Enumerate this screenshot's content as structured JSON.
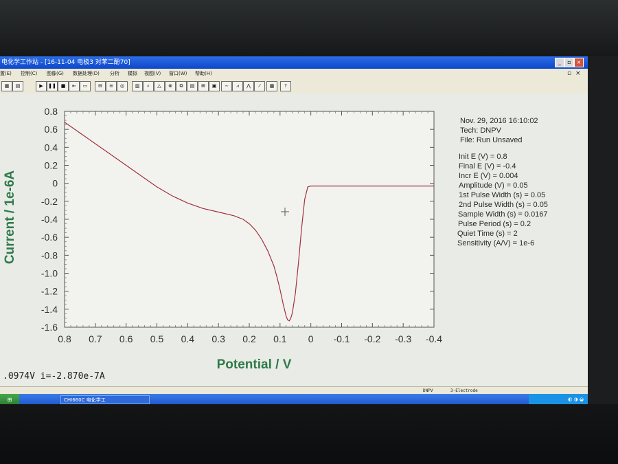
{
  "window": {
    "title": "电化学工作站 - [16-11-04 电极3 对苯二酚70]"
  },
  "menu": [
    "置(E)",
    "控制(C)",
    "图像(G)",
    "数据处理(D)",
    "分析",
    "模拟",
    "视图(V)",
    "窗口(W)",
    "帮助(H)"
  ],
  "info_panel": {
    "date": "Nov. 29, 2016   16:10:02",
    "tech": "Tech: DNPV",
    "file": "File: Run Unsaved",
    "params": [
      "Init E (V) = 0.8",
      "Final E (V) = -0.4",
      "Incr E (V) = 0.004",
      "Amplitude (V) = 0.05",
      "1st Pulse Width (s) = 0.05",
      "2nd Pulse Width (s) = 0.05",
      "Sample Width (s) = 0.0167",
      "Pulse Period (s) = 0.2",
      "Quiet Time (s) = 2",
      "Sensitivity (A/V) = 1e-6"
    ]
  },
  "readout": ".0974V   i=-2.870e-7A",
  "status": {
    "technique": "DNPV",
    "electrode": "3-Electrode"
  },
  "taskbar": {
    "item": "CHI660C 电化学工"
  },
  "chart_data": {
    "type": "line",
    "xlabel": "Potential / V",
    "ylabel": "Current / 1e-6A",
    "xlim": [
      0.8,
      -0.4
    ],
    "ylim": [
      -1.6,
      0.8
    ],
    "x_ticks": [
      "0.8",
      "0.7",
      "0.6",
      "0.5",
      "0.4",
      "0.3",
      "0.2",
      "0.1",
      "0",
      "-0.1",
      "-0.2",
      "-0.3",
      "-0.4"
    ],
    "y_ticks": [
      "0.8",
      "0.6",
      "0.4",
      "0.2",
      "0",
      "-0.2",
      "-0.4",
      "-0.6",
      "-0.8",
      "-1.0",
      "-1.2",
      "-1.4",
      "-1.6"
    ],
    "series": [
      {
        "color": "#a0303a",
        "x": [
          0.8,
          0.75,
          0.7,
          0.65,
          0.6,
          0.55,
          0.5,
          0.45,
          0.4,
          0.35,
          0.3,
          0.25,
          0.22,
          0.2,
          0.18,
          0.16,
          0.14,
          0.12,
          0.11,
          0.1,
          0.09,
          0.08,
          0.075,
          0.07,
          0.065,
          0.06,
          0.05,
          0.04,
          0.03,
          0.02,
          0.01,
          0.0,
          -0.1,
          -0.2,
          -0.3,
          -0.4
        ],
        "y": [
          0.68,
          0.56,
          0.44,
          0.32,
          0.2,
          0.08,
          -0.04,
          -0.14,
          -0.22,
          -0.28,
          -0.32,
          -0.36,
          -0.4,
          -0.45,
          -0.52,
          -0.62,
          -0.75,
          -0.92,
          -1.04,
          -1.18,
          -1.34,
          -1.48,
          -1.52,
          -1.53,
          -1.5,
          -1.44,
          -1.22,
          -0.88,
          -0.5,
          -0.18,
          -0.04,
          -0.03,
          -0.03,
          -0.03,
          -0.03,
          -0.03
        ]
      }
    ],
    "marker_point": {
      "x": 0.097,
      "y": -0.287
    }
  }
}
